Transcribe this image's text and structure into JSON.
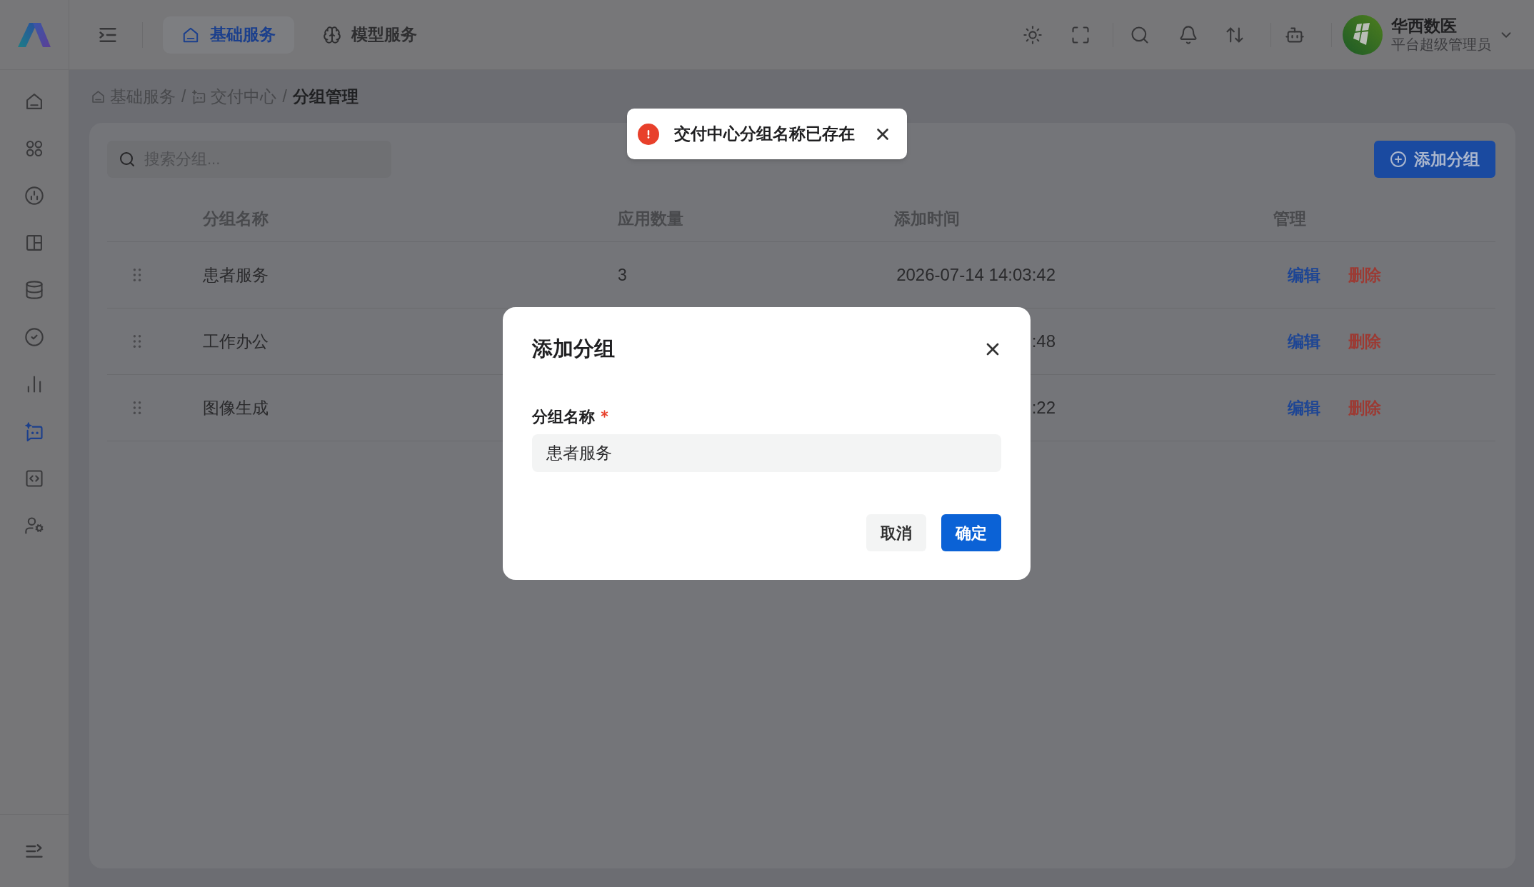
{
  "header": {
    "tabs": [
      {
        "label": "基础服务",
        "selected": true
      },
      {
        "label": "模型服务",
        "selected": false
      }
    ],
    "user": {
      "name": "华西数医",
      "role": "平台超级管理员"
    }
  },
  "sidebar": {
    "items": [
      {
        "selected": false
      },
      {
        "selected": false
      },
      {
        "selected": false
      },
      {
        "selected": false
      },
      {
        "selected": false
      },
      {
        "selected": false
      },
      {
        "selected": false
      },
      {
        "selected": true
      },
      {
        "selected": false
      },
      {
        "selected": false
      }
    ]
  },
  "breadcrumb": [
    {
      "kind": "home",
      "label": "基础服务"
    },
    {
      "kind": "separator",
      "label": "/"
    },
    {
      "kind": "section",
      "label": "交付中心"
    },
    {
      "kind": "separator",
      "label": "/"
    },
    {
      "kind": "current",
      "label": "分组管理"
    }
  ],
  "toolbar": {
    "search": {
      "placeholder": "搜索分组..."
    },
    "add_button": "添加分组"
  },
  "table": {
    "columns": [
      "分组名称",
      "应用数量",
      "添加时间",
      "管理"
    ],
    "rows": [
      {
        "name": "患者服务",
        "count": "3",
        "time": "2026-07-14 14:03:42",
        "actions": [
          {
            "kind": "edit",
            "label": "编辑"
          },
          {
            "kind": "delete",
            "label": "删除"
          }
        ]
      },
      {
        "name": "工作办公",
        "time": ":48",
        "actions": [
          {
            "kind": "edit",
            "label": "编辑"
          },
          {
            "kind": "delete",
            "label": "删除"
          }
        ]
      },
      {
        "name": "图像生成",
        "time": ":22",
        "actions": [
          {
            "kind": "edit",
            "label": "编辑"
          },
          {
            "kind": "delete",
            "label": "删除"
          }
        ]
      }
    ]
  },
  "toast": {
    "kind": "error",
    "message": "交付中心分组名称已存在"
  },
  "dialog": {
    "title": "添加分组",
    "field": {
      "label": "分组名称",
      "required": true,
      "value": "患者服务"
    },
    "buttons": [
      {
        "kind": "secondary",
        "label": "取消"
      },
      {
        "kind": "primary",
        "label": "确定"
      }
    ]
  }
}
